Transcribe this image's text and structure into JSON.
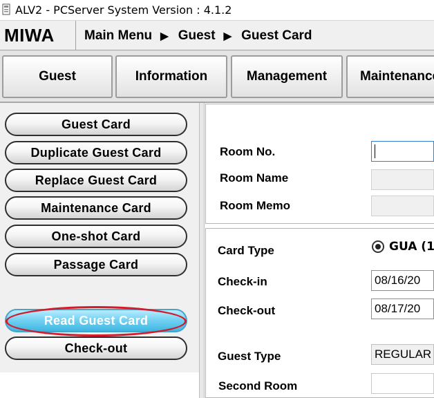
{
  "window": {
    "title": "ALV2 - PCServer System Version : 4.1.2"
  },
  "header": {
    "logo": "MIWA",
    "breadcrumb": [
      "Main Menu",
      "Guest",
      "Guest Card"
    ],
    "separator": "▶"
  },
  "tabs": [
    {
      "label": "Guest"
    },
    {
      "label": "Information"
    },
    {
      "label": "Management"
    },
    {
      "label": "Maintenance"
    }
  ],
  "sidebar": {
    "items": [
      {
        "label": "Guest Card"
      },
      {
        "label": "Duplicate Guest Card"
      },
      {
        "label": "Replace Guest Card"
      },
      {
        "label": "Maintenance Card"
      },
      {
        "label": "One-shot Card"
      },
      {
        "label": "Passage Card"
      },
      {
        "label": "Read Guest Card",
        "active": true
      },
      {
        "label": "Check-out"
      }
    ],
    "highlight_color": "#d21c2c",
    "active_color": "#6fd0f2"
  },
  "room": {
    "room_no_label": "Room No.",
    "room_no_value": "",
    "room_name_label": "Room Name",
    "room_name_value": "",
    "room_memo_label": "Room Memo",
    "room_memo_value": ""
  },
  "card": {
    "card_type_label": "Card Type",
    "card_type_option": "GUA (1",
    "checkin_label": "Check-in",
    "checkin_value": "08/16/20",
    "checkout_label": "Check-out",
    "checkout_value": "08/17/20",
    "guest_type_label": "Guest Type",
    "guest_type_value": "REGULAR",
    "second_room_label": "Second Room",
    "second_room_value": ""
  }
}
